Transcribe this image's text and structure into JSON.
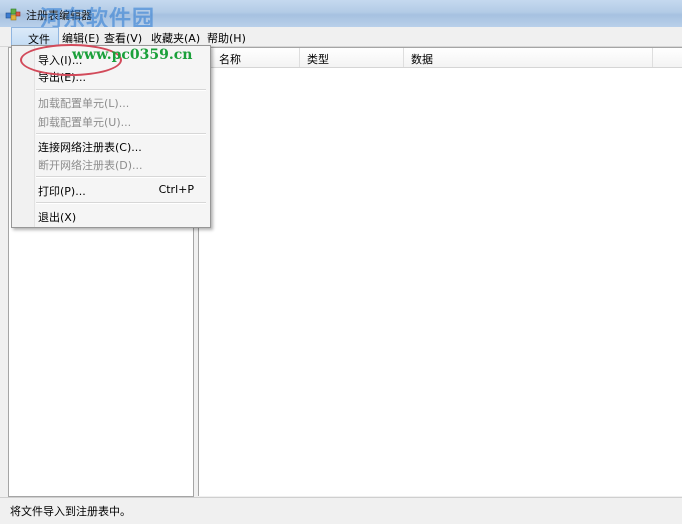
{
  "window": {
    "title": "注册表编辑器",
    "watermark_text": "河东软件园",
    "watermark_url": "www.pc0359.cn"
  },
  "menubar": {
    "file": "文件(F)",
    "edit": "编辑(E)",
    "view": "查看(V)",
    "favorites": "收藏夹(A)",
    "help": "帮助(H)"
  },
  "file_menu": {
    "import": "导入(I)...",
    "export": "导出(E)...",
    "load_hive": "加载配置单元(L)...",
    "unload_hive": "卸载配置单元(U)...",
    "connect": "连接网络注册表(C)...",
    "disconnect": "断开网络注册表(D)...",
    "print": "打印(P)...",
    "print_shortcut": "Ctrl+P",
    "exit": "退出(X)"
  },
  "list": {
    "columns": [
      "名称",
      "类型",
      "数据"
    ]
  },
  "statusbar": {
    "text": "将文件导入到注册表中。"
  },
  "colors": {
    "highlight_oval": "#d24a5a",
    "watermark_url": "#1aa03a"
  }
}
